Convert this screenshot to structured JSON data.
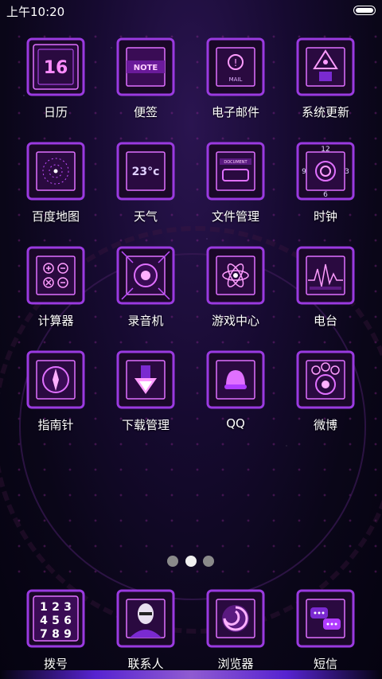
{
  "status": {
    "time": "上午10:20"
  },
  "apps": [
    {
      "label": "日历",
      "icon": "calendar-icon",
      "text": "16"
    },
    {
      "label": "便签",
      "icon": "note-icon",
      "text": "NOTE"
    },
    {
      "label": "电子邮件",
      "icon": "mail-icon",
      "text": "MAIL"
    },
    {
      "label": "系统更新",
      "icon": "system-update-icon",
      "text": ""
    },
    {
      "label": "百度地图",
      "icon": "map-icon",
      "text": ""
    },
    {
      "label": "天气",
      "icon": "weather-icon",
      "text": "23°c"
    },
    {
      "label": "文件管理",
      "icon": "file-manager-icon",
      "text": "DOCUMENT"
    },
    {
      "label": "时钟",
      "icon": "clock-icon",
      "text": ""
    },
    {
      "label": "计算器",
      "icon": "calculator-icon",
      "text": ""
    },
    {
      "label": "录音机",
      "icon": "recorder-icon",
      "text": ""
    },
    {
      "label": "游戏中心",
      "icon": "game-center-icon",
      "text": ""
    },
    {
      "label": "电台",
      "icon": "radio-icon",
      "text": ""
    },
    {
      "label": "指南针",
      "icon": "compass-icon",
      "text": ""
    },
    {
      "label": "下载管理",
      "icon": "download-icon",
      "text": ""
    },
    {
      "label": "QQ",
      "icon": "qq-icon",
      "text": ""
    },
    {
      "label": "微博",
      "icon": "weibo-icon",
      "text": ""
    }
  ],
  "dock": [
    {
      "label": "拨号",
      "icon": "dialer-icon",
      "text": ""
    },
    {
      "label": "联系人",
      "icon": "contacts-icon",
      "text": ""
    },
    {
      "label": "浏览器",
      "icon": "browser-icon",
      "text": ""
    },
    {
      "label": "短信",
      "icon": "messages-icon",
      "text": ""
    }
  ],
  "clock_numerals": [
    "12",
    "3",
    "6",
    "9"
  ],
  "dialer_digits": [
    "1",
    "2",
    "3",
    "4",
    "5",
    "6",
    "7",
    "8",
    "9"
  ],
  "page_indicator": {
    "count": 3,
    "active_index": 1
  },
  "colors": {
    "accent": "#b03cff",
    "frame": "#7a2ad0",
    "glow": "#e070ff"
  }
}
